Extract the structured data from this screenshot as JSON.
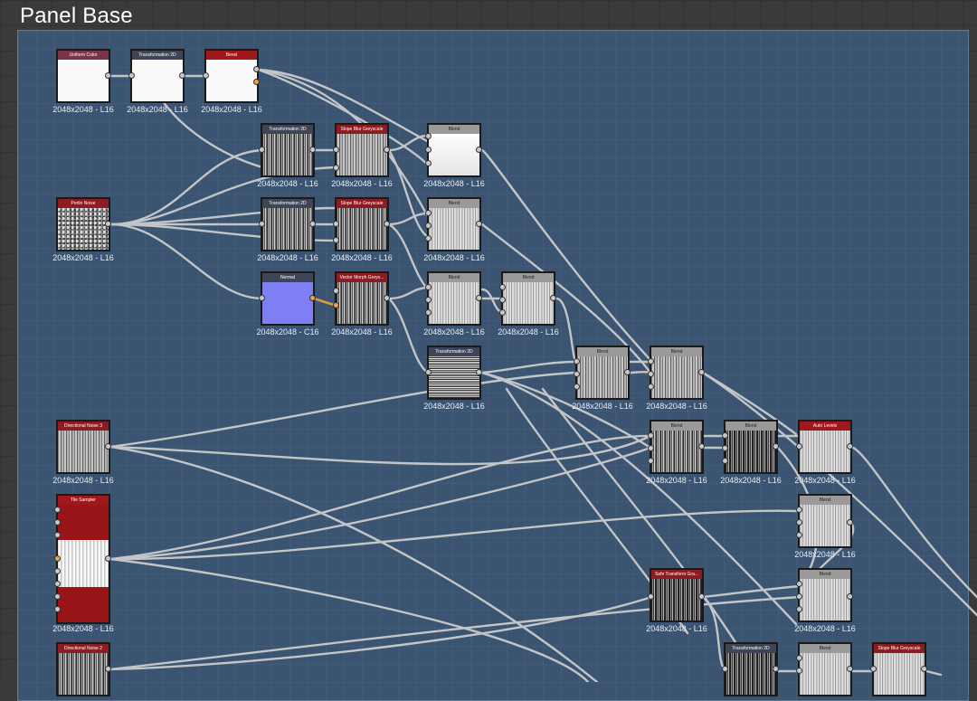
{
  "frame": {
    "title": "Panel Base"
  },
  "nodes": [
    {
      "id": "uniform-color",
      "title": "Uniform Color",
      "label": "2048x2048 - L16"
    },
    {
      "id": "transformation-2d-a",
      "title": "Transformation 2D",
      "label": "2048x2048 - L16"
    },
    {
      "id": "bevel",
      "title": "Bevel",
      "label": "2048x2048 - L16"
    },
    {
      "id": "transformation-2d-b",
      "title": "Transformation 2D",
      "label": "2048x2048 - L16"
    },
    {
      "id": "slope-blur-a",
      "title": "Slope Blur Greyscale",
      "label": "2048x2048 - L16"
    },
    {
      "id": "blend-a",
      "title": "Blend",
      "label": "2048x2048 - L16"
    },
    {
      "id": "perlin-noise",
      "title": "Perlin Noise",
      "label": "2048x2048 - L16"
    },
    {
      "id": "transformation-2d-c",
      "title": "Transformation 2D",
      "label": "2048x2048 - L16"
    },
    {
      "id": "slope-blur-b",
      "title": "Slope Blur Greyscale",
      "label": "2048x2048 - L16"
    },
    {
      "id": "blend-b",
      "title": "Blend",
      "label": "2048x2048 - L16"
    },
    {
      "id": "normal",
      "title": "Normal",
      "label": "2048x2048 - C16"
    },
    {
      "id": "vector-morph",
      "title": "Vector Morph Greys...",
      "label": "2048x2048 - L16"
    },
    {
      "id": "blend-c",
      "title": "Blend",
      "label": "2048x2048 - L16"
    },
    {
      "id": "blend-d",
      "title": "Blend",
      "label": "2048x2048 - L16"
    },
    {
      "id": "transformation-2d-d",
      "title": "Transformation 2D",
      "label": "2048x2048 - L16"
    },
    {
      "id": "blend-e",
      "title": "Blend",
      "label": "2048x2048 - L16"
    },
    {
      "id": "blend-f",
      "title": "Blend",
      "label": "2048x2048 - L16"
    },
    {
      "id": "directional-noise-3",
      "title": "Directional Noise 3",
      "label": "2048x2048 - L16"
    },
    {
      "id": "blend-g",
      "title": "Blend",
      "label": "2048x2048 - L16"
    },
    {
      "id": "blend-h",
      "title": "Blend",
      "label": "2048x2048 - L16"
    },
    {
      "id": "auto-levels",
      "title": "Auto Levels",
      "label": "2048x2048 - L16"
    },
    {
      "id": "tile-sampler",
      "title": "Tile Sampler",
      "label": "2048x2048 - L16"
    },
    {
      "id": "blend-i",
      "title": "Blend",
      "label": "2048x2048 - L16"
    },
    {
      "id": "safe-transform",
      "title": "Safe Transform Gra...",
      "label": "2048x2048 - L16"
    },
    {
      "id": "blend-j",
      "title": "Blend",
      "label": "2048x2048 - L16"
    },
    {
      "id": "directional-noise-2",
      "title": "Directional Noise 2",
      "label": ""
    },
    {
      "id": "transformation-2d-e",
      "title": "Transformation 2D",
      "label": ""
    },
    {
      "id": "blend-k",
      "title": "Blend",
      "label": ""
    },
    {
      "id": "slope-blur-c",
      "title": "Slope Blur Greyscale",
      "label": ""
    }
  ]
}
